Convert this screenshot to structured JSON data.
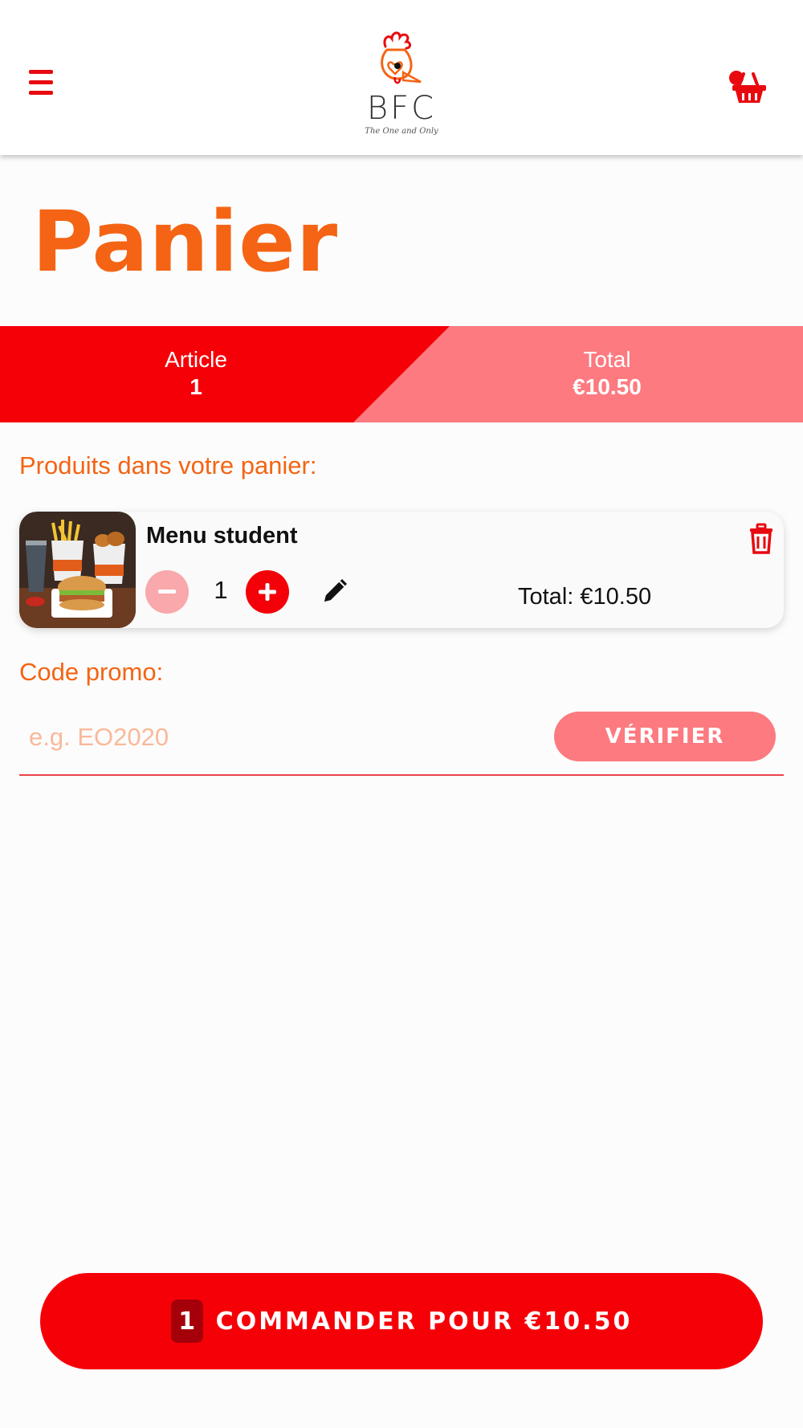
{
  "header": {
    "menu_icon": "hamburger-menu-icon",
    "logo_text": "BFC",
    "logo_tagline": "The One and Only",
    "cart_icon": "shopping-basket-icon"
  },
  "page": {
    "title": "Panier"
  },
  "summary": {
    "article_label": "Article",
    "article_value": "1",
    "total_label": "Total",
    "total_value": "€10.50"
  },
  "cart": {
    "section_label": "Produits dans votre panier:",
    "items": [
      {
        "name": "Menu student",
        "quantity": "1",
        "total_text": "Total: €10.50"
      }
    ]
  },
  "promo": {
    "label": "Code promo:",
    "placeholder": "e.g. EO2020",
    "value": "",
    "verify_label": "VÉRIFIER"
  },
  "order_button": {
    "count": "1",
    "label": "COMMANDER POUR €10.50"
  },
  "colors": {
    "accent_red": "#f60008",
    "accent_orange": "#f46414",
    "light_red": "#fc7a80",
    "pale_red": "#f9a8ab"
  }
}
